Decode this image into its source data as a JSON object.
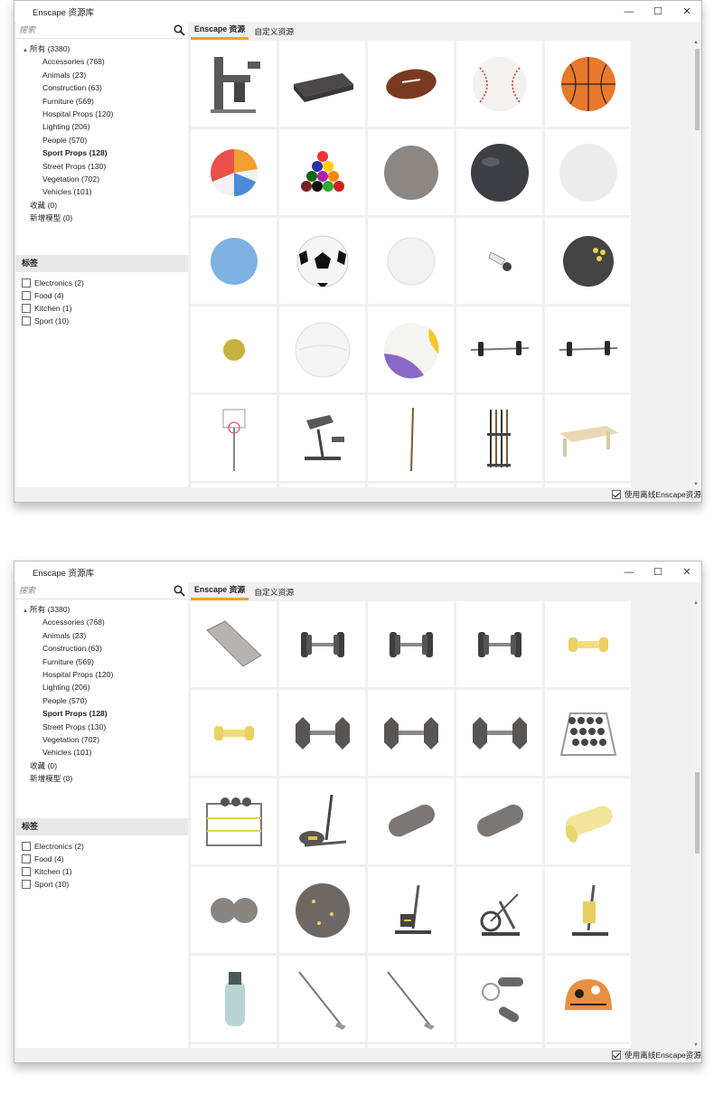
{
  "colors": {
    "accent": "#f0a020",
    "window_bg": "#f0f0f0",
    "panel_bg": "#ffffff"
  },
  "windows": [
    {
      "title": "Enscape 资源库",
      "controls": [
        "—",
        "☐",
        "✕"
      ],
      "search": {
        "placeholder": "搜索",
        "value": ""
      },
      "tree": {
        "root": {
          "caret": "▲",
          "label": "所有 (3380)"
        },
        "categories": [
          {
            "label": "Accessories (768)",
            "selected": false
          },
          {
            "label": "Animals (23)",
            "selected": false
          },
          {
            "label": "Construction (63)",
            "selected": false
          },
          {
            "label": "Furniture (569)",
            "selected": false
          },
          {
            "label": "Hospital Props (120)",
            "selected": false
          },
          {
            "label": "Lighting (206)",
            "selected": false
          },
          {
            "label": "People (570)",
            "selected": false
          },
          {
            "label": "Sport Props (128)",
            "selected": true
          },
          {
            "label": "Street Props (130)",
            "selected": false
          },
          {
            "label": "Vegetation (702)",
            "selected": false
          },
          {
            "label": "Vehicles (101)",
            "selected": false
          }
        ],
        "extras": [
          {
            "label": "收藏 (0)"
          },
          {
            "label": "新增模型 (0)"
          }
        ]
      },
      "tags_header": "标签",
      "tags": [
        {
          "label": "Electronics (2)",
          "checked": false
        },
        {
          "label": "Food (4)",
          "checked": false
        },
        {
          "label": "Kitchen (1)",
          "checked": false
        },
        {
          "label": "Sport (10)",
          "checked": false
        }
      ],
      "tabs": [
        {
          "label": "Enscape 资源",
          "active": true
        },
        {
          "label": "自定义资源",
          "active": false
        }
      ],
      "assets": [
        "leg-press-machine-icon",
        "step-platform-icon",
        "american-football-icon",
        "baseball-icon",
        "basketball-icon",
        "beach-ball-icon",
        "billiard-balls-rack-icon",
        "grey-stone-ball-icon",
        "dark-bowling-ball-icon",
        "white-ball-icon",
        "blue-ball-icon",
        "soccer-ball-icon",
        "golf-ball-icon",
        "shuttlecock-icon",
        "bowling-ball-icon",
        "tennis-ball-icon",
        "white-volleyball-icon",
        "volleyball-icon",
        "barbell-icon",
        "barbell-icon",
        "basketball-hoop-icon",
        "weight-bench-icon",
        "pool-cue-icon",
        "cue-rack-icon",
        "pool-table-icon"
      ],
      "offline_checkbox": {
        "label": "使用离线Enscape资源",
        "checked": true
      }
    },
    {
      "title": "Enscape 资源库",
      "controls": [
        "—",
        "☐",
        "✕"
      ],
      "search": {
        "placeholder": "搜索",
        "value": ""
      },
      "tree": {
        "root": {
          "caret": "▲",
          "label": "所有 (3380)"
        },
        "categories": [
          {
            "label": "Accessories (768)",
            "selected": false
          },
          {
            "label": "Animals (23)",
            "selected": false
          },
          {
            "label": "Construction (63)",
            "selected": false
          },
          {
            "label": "Furniture (569)",
            "selected": false
          },
          {
            "label": "Hospital Props (120)",
            "selected": false
          },
          {
            "label": "Lighting (206)",
            "selected": false
          },
          {
            "label": "People (570)",
            "selected": false
          },
          {
            "label": "Sport Props (128)",
            "selected": true
          },
          {
            "label": "Street Props (130)",
            "selected": false
          },
          {
            "label": "Vegetation (702)",
            "selected": false
          },
          {
            "label": "Vehicles (101)",
            "selected": false
          }
        ],
        "extras": [
          {
            "label": "收藏 (0)"
          },
          {
            "label": "新增模型 (0)"
          }
        ]
      },
      "tags_header": "标签",
      "tags": [
        {
          "label": "Electronics (2)",
          "checked": false
        },
        {
          "label": "Food (4)",
          "checked": false
        },
        {
          "label": "Kitchen (1)",
          "checked": false
        },
        {
          "label": "Sport (10)",
          "checked": false
        }
      ],
      "tabs": [
        {
          "label": "Enscape 资源",
          "active": true
        },
        {
          "label": "自定义资源",
          "active": false
        }
      ],
      "assets": [
        "exercise-mat-icon",
        "dumbbell-icon",
        "dumbbell-icon",
        "dumbbell-icon",
        "yellow-dumbbell-icon",
        "yellow-dumbbell-icon",
        "hex-dumbbell-icon",
        "hex-dumbbell-icon",
        "hex-dumbbell-icon",
        "dumbbell-rack-icon",
        "weight-rack-icon",
        "elliptical-trainer-icon",
        "foam-roller-icon",
        "foam-roller-icon",
        "yellow-foam-roller-icon",
        "peanut-massage-ball-icon",
        "massage-ball-icon",
        "exercise-bike-icon",
        "spin-bike-icon",
        "yellow-exercise-bike-icon",
        "golf-bag-icon",
        "golf-club-icon",
        "golf-club-icon",
        "hand-grip-icon",
        "helmet-icon"
      ],
      "offline_checkbox": {
        "label": "使用离线Enscape资源",
        "checked": true
      }
    }
  ]
}
